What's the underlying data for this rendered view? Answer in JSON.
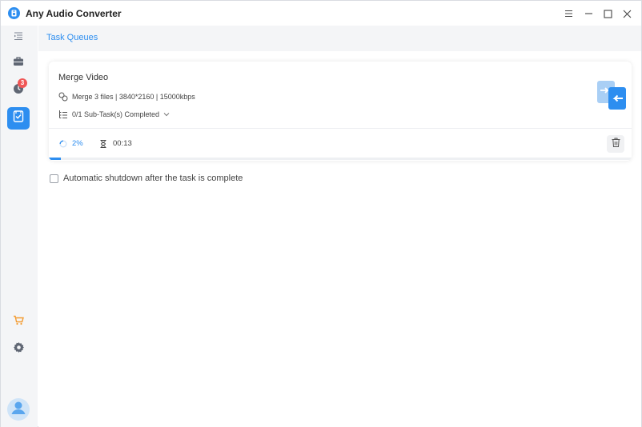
{
  "app": {
    "title": "Any Audio Converter"
  },
  "window_controls": {
    "menu": "menu-icon",
    "minimize": "minimize-icon",
    "maximize": "maximize-icon",
    "close": "close-icon"
  },
  "sidebar": {
    "items": [
      {
        "name": "collapse-sidebar",
        "icon": "collapse-list-icon"
      },
      {
        "name": "toolbox",
        "icon": "briefcase-icon"
      },
      {
        "name": "history",
        "icon": "clock-icon",
        "badge": "3"
      },
      {
        "name": "task-queues",
        "icon": "bookmark-check-icon",
        "active": true
      },
      {
        "name": "store",
        "icon": "cart-icon"
      },
      {
        "name": "settings",
        "icon": "gear-icon"
      },
      {
        "name": "account",
        "icon": "user-icon"
      }
    ]
  },
  "header": {
    "tab_title": "Task Queues"
  },
  "task": {
    "title": "Merge Video",
    "details": "Merge 3 files | 3840*2160 | 15000kbps",
    "subtasks": "0/1 Sub-Task(s) Completed",
    "progress_label": "2%",
    "progress_value": 0.02,
    "elapsed": "00:13"
  },
  "options": {
    "auto_shutdown_label": "Automatic shutdown after the task is complete",
    "auto_shutdown_checked": false
  },
  "colors": {
    "accent": "#2d8ef0",
    "badge": "#f05656",
    "cart": "#f39c32"
  }
}
